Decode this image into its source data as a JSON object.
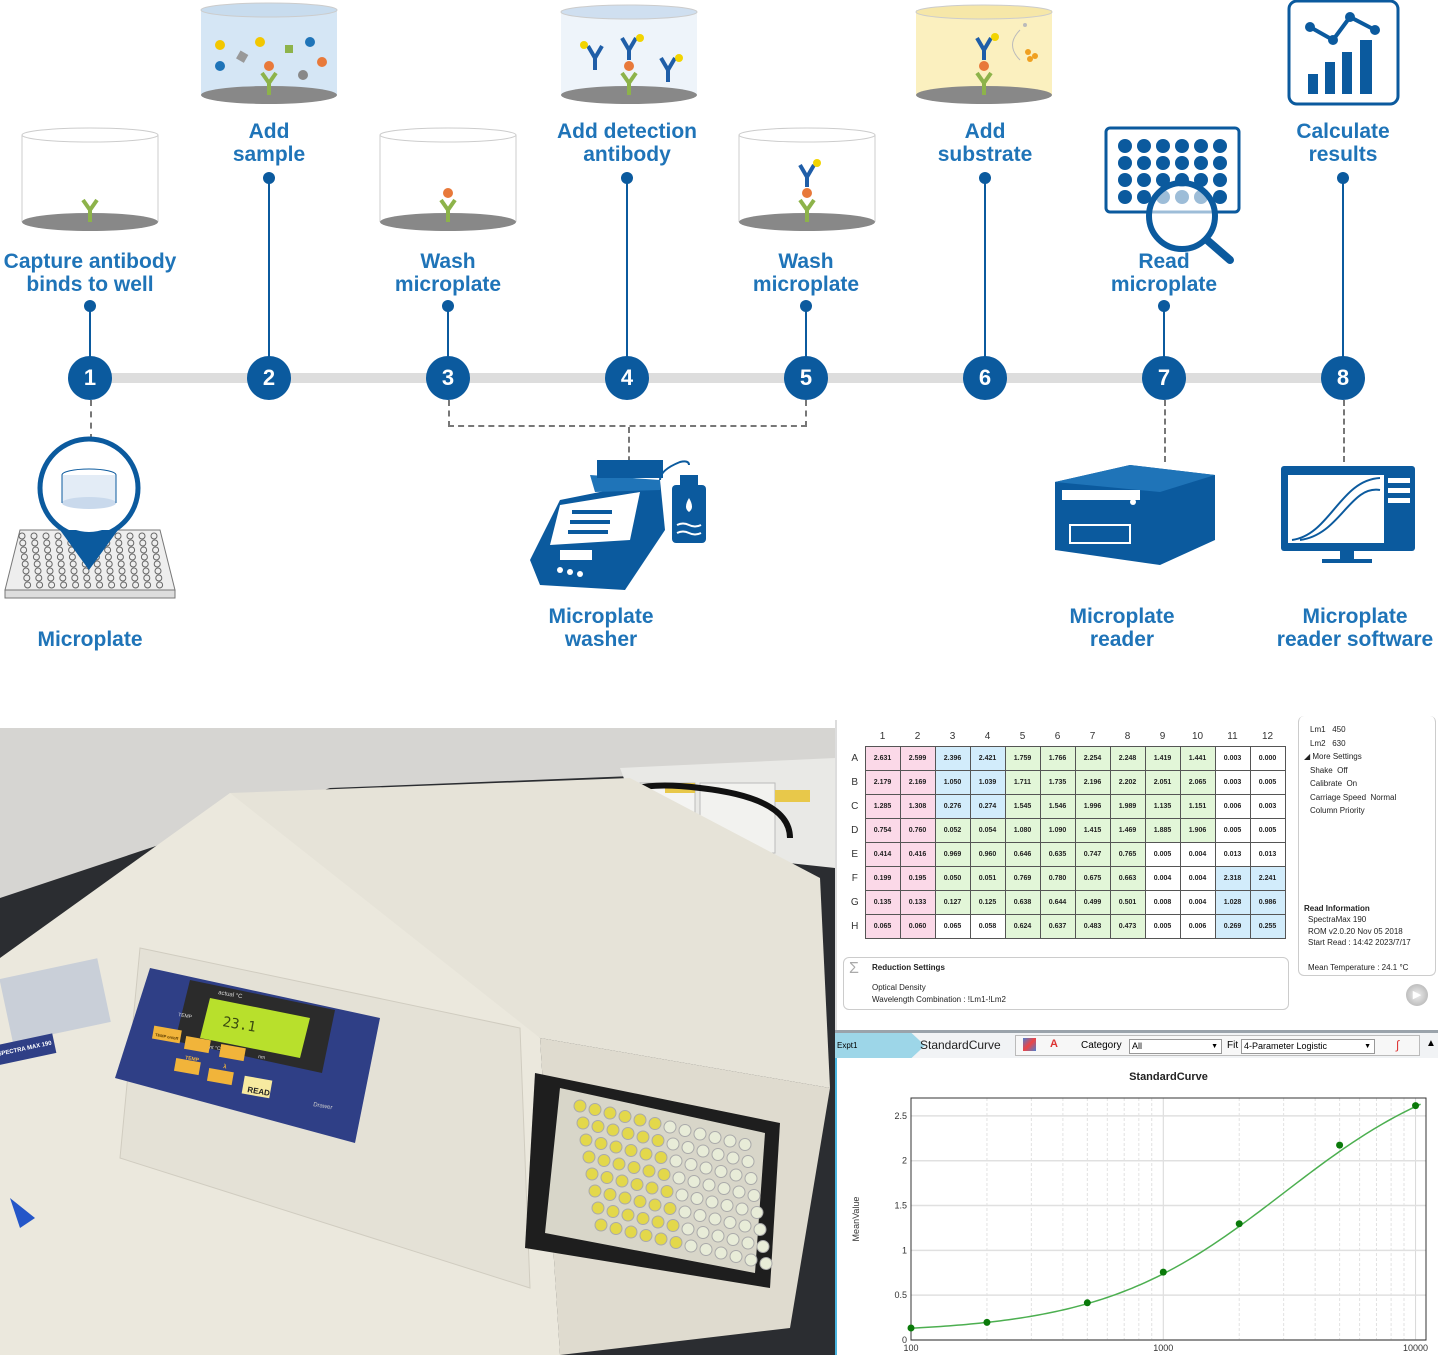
{
  "workflow": {
    "steps": [
      {
        "number": "1",
        "label": [
          "Capture antibody",
          "binds to well"
        ]
      },
      {
        "number": "2",
        "label": [
          "Add",
          "sample"
        ]
      },
      {
        "number": "3",
        "label": [
          "Wash",
          "microplate"
        ]
      },
      {
        "number": "4",
        "label": [
          "Add detection",
          "antibody"
        ]
      },
      {
        "number": "5",
        "label": [
          "Wash",
          "microplate"
        ]
      },
      {
        "number": "6",
        "label": [
          "Add",
          "substrate"
        ]
      },
      {
        "number": "7",
        "label": [
          "Read",
          "microplate"
        ]
      },
      {
        "number": "8",
        "label": [
          "Calculate",
          "results"
        ]
      }
    ],
    "tools": [
      {
        "label": [
          "Microplate"
        ]
      },
      {
        "label": [
          "Microplate",
          "washer"
        ]
      },
      {
        "label": [
          "Microplate",
          "reader"
        ]
      },
      {
        "label": [
          "Microplate",
          "reader software"
        ]
      }
    ],
    "colors": {
      "primary": "#0b5a9e",
      "label": "#1f74b8",
      "timeline": "#dddddd"
    }
  },
  "instrument_photo": {
    "brand_label": "SPECTRA MAX 190",
    "display_value": "23.1",
    "display_top_label": "actual °C",
    "display_bottom_label": "setpoint °C",
    "display_nm_label": "nm",
    "display_side_label": "TEMP",
    "buttons": {
      "temp_onoff": "TEMP on/off",
      "temp": "TEMP",
      "lambda": "λ",
      "read": "READ"
    },
    "drawer_label": "Drawer"
  },
  "software": {
    "plate": {
      "columns": [
        "1",
        "2",
        "3",
        "4",
        "5",
        "6",
        "7",
        "8",
        "9",
        "10",
        "11",
        "12"
      ],
      "rows": [
        {
          "label": "A",
          "values": [
            "2.631",
            "2.599",
            "2.396",
            "2.421",
            "1.759",
            "1.766",
            "2.254",
            "2.248",
            "1.419",
            "1.441",
            "0.003",
            "0.000"
          ],
          "colors": "ppbbggggggww"
        },
        {
          "label": "B",
          "values": [
            "2.179",
            "2.169",
            "1.050",
            "1.039",
            "1.711",
            "1.735",
            "2.196",
            "2.202",
            "2.051",
            "2.065",
            "0.003",
            "0.005"
          ],
          "colors": "ppbbggggggww"
        },
        {
          "label": "C",
          "values": [
            "1.285",
            "1.308",
            "0.276",
            "0.274",
            "1.545",
            "1.546",
            "1.996",
            "1.989",
            "1.135",
            "1.151",
            "0.006",
            "0.003"
          ],
          "colors": "ppbbggggggww"
        },
        {
          "label": "D",
          "values": [
            "0.754",
            "0.760",
            "0.052",
            "0.054",
            "1.080",
            "1.090",
            "1.415",
            "1.469",
            "1.885",
            "1.906",
            "0.005",
            "0.005"
          ],
          "colors": "ppggggggggww"
        },
        {
          "label": "E",
          "values": [
            "0.414",
            "0.416",
            "0.969",
            "0.960",
            "0.646",
            "0.635",
            "0.747",
            "0.765",
            "0.005",
            "0.004",
            "0.013",
            "0.013"
          ],
          "colors": "ppggggggwwww"
        },
        {
          "label": "F",
          "values": [
            "0.199",
            "0.195",
            "0.050",
            "0.051",
            "0.769",
            "0.780",
            "0.675",
            "0.663",
            "0.004",
            "0.004",
            "2.318",
            "2.241"
          ],
          "colors": "ppggggggwwbb"
        },
        {
          "label": "G",
          "values": [
            "0.135",
            "0.133",
            "0.127",
            "0.125",
            "0.638",
            "0.644",
            "0.499",
            "0.501",
            "0.008",
            "0.004",
            "1.028",
            "0.986"
          ],
          "colors": "ppggggggwwbb"
        },
        {
          "label": "H",
          "values": [
            "0.065",
            "0.060",
            "0.065",
            "0.058",
            "0.624",
            "0.637",
            "0.483",
            "0.473",
            "0.005",
            "0.006",
            "0.269",
            "0.255"
          ],
          "colors": "ppwwggggwwbb"
        }
      ],
      "cell_colors": {
        "p": "#fbd9e8",
        "b": "#d2ecfb",
        "g": "#e2f6d8",
        "w": "#ffffff"
      }
    },
    "settings": {
      "lines": [
        "Lm1   450",
        "Lm2   630",
        "◢ More Settings",
        "Shake  Off",
        "Calibrate  On",
        "Carriage Speed  Normal",
        "Column Priority"
      ]
    },
    "read_info": {
      "title": "Read Information",
      "lines": [
        "SpectraMax 190",
        "ROM v2.0.20 Nov 05 2018",
        "Start Read : 14:42 2023/7/17"
      ],
      "mean_temperature": "Mean Temperature : 24.1 °C"
    },
    "reduction": {
      "title": "Reduction Settings",
      "lines": [
        "Optical Density",
        "Wavelength Combination : !Lm1-!Lm2"
      ]
    },
    "toolbar": {
      "experiment": "Expt1",
      "section": "StandardCurve",
      "category_label": "Category",
      "category_value": "All",
      "fit_label": "Fit",
      "fit_value": "4-Parameter Logistic"
    }
  },
  "chart_data": {
    "type": "scatter",
    "title": "StandardCurve",
    "xlabel": "",
    "ylabel": "MeanValue",
    "x_scale": "log",
    "xlim": [
      100,
      11000
    ],
    "ylim": [
      0,
      2.7
    ],
    "x_ticks": [
      "100",
      "1000",
      "10000"
    ],
    "y_ticks": [
      "0",
      "0.5",
      "1",
      "1.5",
      "2",
      "2.5"
    ],
    "grid": true,
    "fit": "4-Parameter Logistic",
    "series": [
      {
        "x": [
          100,
          200,
          500,
          1000,
          2000,
          5000,
          10000
        ],
        "y": [
          0.134,
          0.197,
          0.415,
          0.757,
          1.297,
          2.174,
          2.615
        ],
        "color": "#0a7a0a"
      }
    ]
  }
}
